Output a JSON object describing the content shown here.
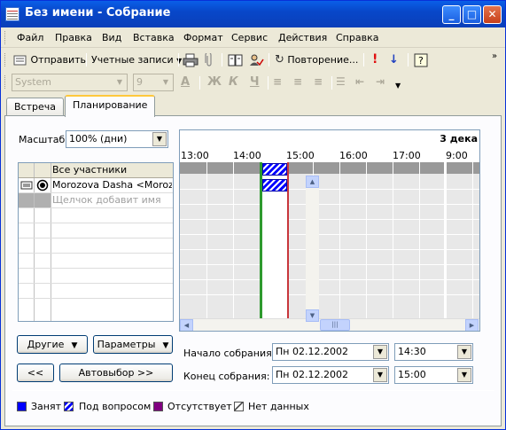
{
  "window": {
    "title": "Без имени - Собрание"
  },
  "menu": [
    "Файл",
    "Правка",
    "Вид",
    "Вставка",
    "Формат",
    "Сервис",
    "Действия",
    "Справка"
  ],
  "toolbar": {
    "send": "Отправить",
    "accounts": "Учетные записи",
    "recurrence": "Повторение..."
  },
  "format_toolbar": {
    "font": "System",
    "size": "9",
    "bold": "Ж",
    "italic": "К",
    "underline": "Ч"
  },
  "tabs": {
    "meeting": "Встреча",
    "planning": "Планирование"
  },
  "planning": {
    "scale_label": "Масштаб:",
    "scale_value": "100% (дни)",
    "all_attendees": "Все участники",
    "attendee_name": "Morozova Dasha <Morozova",
    "add_name_hint": "Щелчок добавит имя",
    "date_header": "3 дека",
    "hours": [
      "13:00",
      "14:00",
      "15:00",
      "16:00",
      "17:00",
      "9:00"
    ],
    "others_button": "Другие",
    "options_button": "Параметры",
    "prev_button": "<<",
    "autopick_button": "Автовыбор >>",
    "start_label": "Начало собрания:",
    "start_date": "Пн 02.12.2002",
    "start_time": "14:30",
    "end_label": "Конец собрания:",
    "end_date": "Пн 02.12.2002",
    "end_time": "15:00"
  },
  "legend": {
    "busy": "Занят",
    "tentative": "Под вопросом",
    "out_of_office": "Отсутствует",
    "no_info": "Нет данных",
    "colors": {
      "busy": "#0000ff",
      "tentative": "#0000ff",
      "out_of_office": "#800080",
      "no_info": "#ffffff"
    }
  }
}
